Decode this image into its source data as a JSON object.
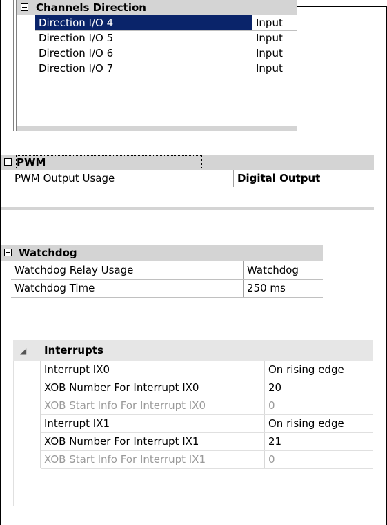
{
  "panel1": {
    "category": "Channels Direction",
    "rows": [
      {
        "name": "Direction I/O 4",
        "value": "Input",
        "selected": true
      },
      {
        "name": "Direction I/O 5",
        "value": "Input"
      },
      {
        "name": "Direction I/O 6",
        "value": "Input"
      },
      {
        "name": "Direction I/O 7",
        "value": "Input"
      }
    ]
  },
  "panel2": {
    "category": "PWM",
    "rows": [
      {
        "name": "PWM Output Usage",
        "value": "Digital Output"
      }
    ]
  },
  "panel3": {
    "category": "Watchdog",
    "rows": [
      {
        "name": "Watchdog Relay Usage",
        "value": "Watchdog"
      },
      {
        "name": "Watchdog Time",
        "value": "250 ms"
      }
    ]
  },
  "panel4": {
    "category": "Interrupts",
    "rows": [
      {
        "name": "Interrupt IX0",
        "value": "On rising edge"
      },
      {
        "name": "XOB Number For Interrupt IX0",
        "value": "20"
      },
      {
        "name": "XOB Start Info For Interrupt IX0",
        "value": "0",
        "disabled": true
      },
      {
        "name": "Interrupt IX1",
        "value": "On rising edge"
      },
      {
        "name": "XOB Number For Interrupt IX1",
        "value": "21"
      },
      {
        "name": "XOB Start Info For Interrupt IX1",
        "value": "0",
        "disabled": true
      }
    ]
  },
  "colors": {
    "selection": "#0a246a",
    "category_bg": "#d4d4d4",
    "disabled_text": "#9a9a9a"
  }
}
